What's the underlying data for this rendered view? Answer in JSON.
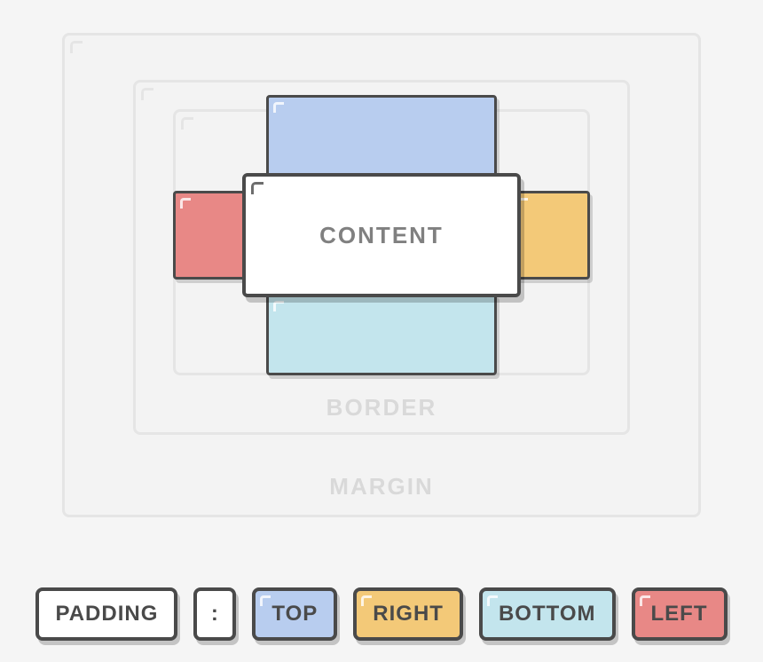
{
  "boxmodel": {
    "margin_label": "MARGIN",
    "border_label": "BORDER",
    "content_label": "CONTENT"
  },
  "tokens": {
    "property": "PADDING",
    "separator": ":",
    "top": "TOP",
    "right": "RIGHT",
    "bottom": "BOTTOM",
    "left": "LEFT"
  },
  "colors": {
    "top": "#b8cdef",
    "right": "#f3c978",
    "bottom": "#c3e5ed",
    "left": "#e88886",
    "border": "#4a4a4a",
    "faded": "#e5e5e5",
    "bg": "#f5f5f5"
  }
}
